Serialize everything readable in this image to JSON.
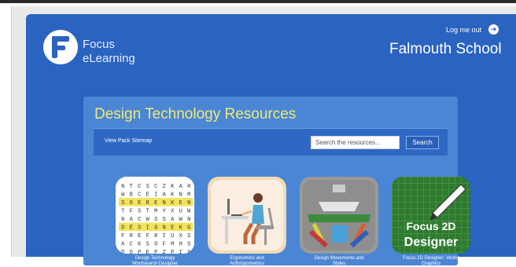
{
  "header": {
    "logo_line1": "Focus",
    "logo_line2": "eLearning",
    "logout_label": "Log me out",
    "school_name": "Falmouth School"
  },
  "resources": {
    "title": "Design Technology Resources",
    "sitemap_link": "View Pack Sitemap",
    "search_placeholder": "Search the resources...",
    "search_button": "Search",
    "items": [
      {
        "caption_line1": "Design Technology",
        "caption_line2": "Wordsearch Designer"
      },
      {
        "caption_line1": "Ergonomics and",
        "caption_line2": "Anthropometrics"
      },
      {
        "caption_line1": "Design Movements and",
        "caption_line2": "Styles"
      },
      {
        "caption_line1": "Focus 2D Designer: Vector",
        "caption_line2": "Graphics",
        "thumb_text_line1": "Focus 2D",
        "thumb_text_line2": "Designer"
      }
    ]
  },
  "wordsearch_grid": [
    "NTCSCZKAH",
    "WBCEIAKNM",
    "SOERENKEN",
    "TFSTMYXUW",
    "NACWSSAWN",
    "DESIGNEKG",
    "FREFRIUXS",
    "ACKSOFMHS",
    "DOPEPZPIX"
  ],
  "colors": {
    "app_bg": "#2b63c1",
    "panel_bg": "#4a86d4",
    "title_color": "#f1ea7a",
    "highlight": "#f3e35a"
  }
}
